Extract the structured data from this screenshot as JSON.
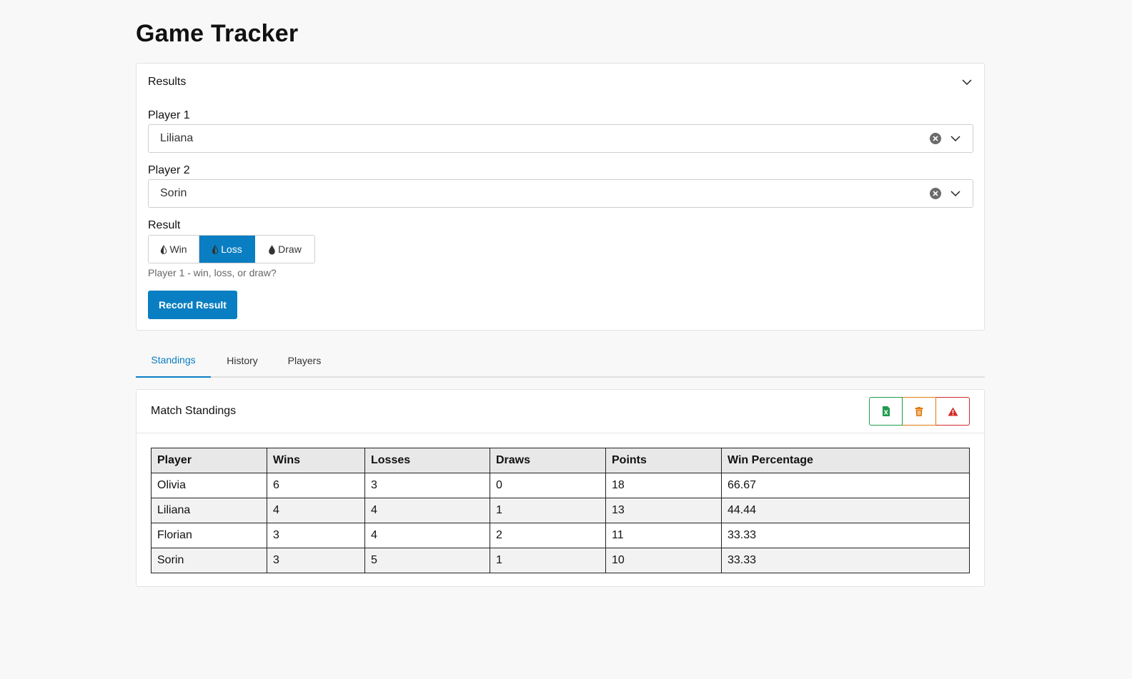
{
  "app": {
    "title": "Game Tracker"
  },
  "results": {
    "title": "Results",
    "player1": {
      "label": "Player 1",
      "value": "Liliana"
    },
    "player2": {
      "label": "Player 2",
      "value": "Sorin"
    },
    "result": {
      "label": "Result",
      "options": [
        {
          "label": "Win",
          "selected": false
        },
        {
          "label": "Loss",
          "selected": true
        },
        {
          "label": "Draw",
          "selected": false
        }
      ],
      "helper": "Player 1 - win, loss, or draw?"
    },
    "submit_label": "Record Result"
  },
  "tabs": [
    {
      "label": "Standings",
      "active": true
    },
    {
      "label": "History",
      "active": false
    },
    {
      "label": "Players",
      "active": false
    }
  ],
  "standings": {
    "title": "Match Standings",
    "actions": [
      {
        "icon": "excel-file-icon",
        "color": "#1e9b4b"
      },
      {
        "icon": "trash-icon",
        "color": "#e07b10"
      },
      {
        "icon": "warning-icon",
        "color": "#d42a2a"
      }
    ],
    "columns": [
      "Player",
      "Wins",
      "Losses",
      "Draws",
      "Points",
      "Win Percentage"
    ],
    "rows": [
      [
        "Olivia",
        "6",
        "3",
        "0",
        "18",
        "66.67"
      ],
      [
        "Liliana",
        "4",
        "4",
        "1",
        "13",
        "44.44"
      ],
      [
        "Florian",
        "3",
        "4",
        "2",
        "11",
        "33.33"
      ],
      [
        "Sorin",
        "3",
        "5",
        "1",
        "10",
        "33.33"
      ]
    ]
  },
  "colors": {
    "accent": "#0a7ec2",
    "background": "#f8f8f8"
  }
}
